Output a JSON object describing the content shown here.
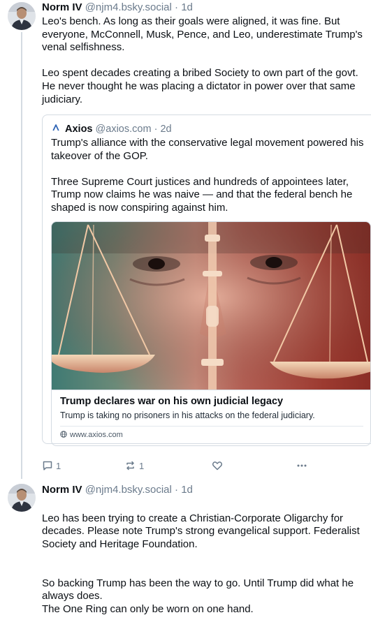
{
  "posts": [
    {
      "author": {
        "name": "Norm IV",
        "handle": "@njm4.bsky.social",
        "time": "1d"
      },
      "separator": "·",
      "paragraphs": [
        "Leo's bench.  As long as their goals were aligned, it was fine.  But everyone, McConnell, Musk, Pence, and Leo, underestimate Trump's venal selfishness.",
        "Leo spent decades creating a bribed Society to own part of the govt. He never thought he was placing a dictator in power over that same judiciary."
      ],
      "quote": {
        "name": "Axios",
        "handle": "@axios.com",
        "time": "2d",
        "paragraphs": [
          "Trump's alliance with the conservative legal movement powered his takeover of the GOP.",
          "Three Supreme Court justices and hundreds of appointees later, Trump now claims he was naive — and that the federal bench he shaped is now conspiring against him."
        ],
        "card": {
          "title": "Trump declares war on his own judicial legacy",
          "description": "Trump is taking no prisoners in his attacks on the federal judiciary.",
          "domain": "www.axios.com"
        }
      },
      "actions": {
        "reply_count": "1",
        "repost_count": "1"
      },
      "icons": [
        "reply-icon",
        "repost-icon",
        "heart-icon",
        "more-dots-icon"
      ]
    },
    {
      "author": {
        "name": "Norm IV",
        "handle": "@njm4.bsky.social",
        "time": "1d"
      },
      "separator": "·",
      "paragraphs": [
        "Leo has been trying to create a Christian-Corporate Oligarchy for decades.  Please note Trump's strong evangelical support.  Federalist Society and Heritage Foundation.",
        "So backing Trump has been the way to go. Until Trump did what he always does.\nThe One Ring can only be worn on one hand."
      ]
    }
  ],
  "colors": {
    "text": "#0b0f14",
    "muted": "#6b7b8c",
    "border": "#d4dbe2",
    "axios_blue": "#2e64b5"
  }
}
